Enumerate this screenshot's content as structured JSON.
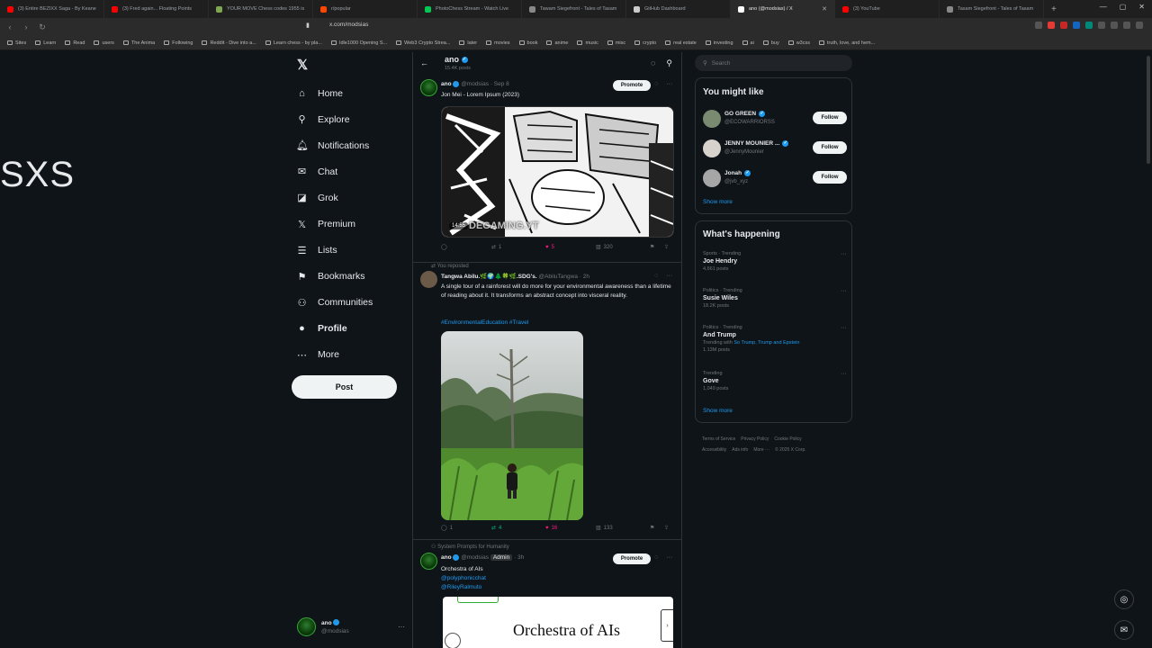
{
  "browser": {
    "tabs": [
      {
        "label": "(3) Entire BEZIXX Saga - By Keane",
        "color": "#ff0000"
      },
      {
        "label": "(3) Fred again... Floating Points",
        "color": "#ff0000"
      },
      {
        "label": "YOUR MOVE Chess codes 1955 is",
        "color": "#7fa650"
      },
      {
        "label": "r/popular",
        "color": "#ff4500"
      },
      {
        "label": "PhotoChess Stream - Watch Live",
        "color": "#00c853"
      },
      {
        "label": "Tawam Siegefront - Tales of Tasam",
        "color": "#888888"
      },
      {
        "label": "GitHub Dashboard",
        "color": "#cccccc"
      },
      {
        "label": "ano (@modsias) / X",
        "color": "#ffffff"
      },
      {
        "label": "(3) YouTube",
        "color": "#ff0000"
      },
      {
        "label": "Tasam Siegefront - Tales of Tasam",
        "color": "#888888"
      }
    ],
    "url": "x.com/modsias",
    "bookmarks": [
      "Sites",
      "Learn",
      "Read",
      "users",
      "The Anima",
      "Following",
      "Reddit - Dive into a...",
      "Learn chess - by pla...",
      "Idle1000 Opening S...",
      "Web3 Crypto Strea...",
      "later",
      "movies",
      "book",
      "anime",
      "music",
      "misc",
      "crypto",
      "real estate",
      "investing",
      "ai",
      "buy",
      "w3css",
      "truth, love, and hem..."
    ]
  },
  "overlay_text": "SXS",
  "nav": {
    "items": [
      {
        "label": "Home",
        "icon": "⌂",
        "name": "home"
      },
      {
        "label": "Explore",
        "icon": "⚲",
        "name": "explore"
      },
      {
        "label": "Notifications",
        "icon": "🔔︎",
        "name": "notifications"
      },
      {
        "label": "Chat",
        "icon": "✉",
        "name": "chat"
      },
      {
        "label": "Grok",
        "icon": "◪",
        "name": "grok"
      },
      {
        "label": "Premium",
        "icon": "𝕏",
        "name": "premium"
      },
      {
        "label": "Lists",
        "icon": "☰",
        "name": "lists"
      },
      {
        "label": "Bookmarks",
        "icon": "⚑",
        "name": "bookmarks"
      },
      {
        "label": "Communities",
        "icon": "⚇",
        "name": "communities"
      },
      {
        "label": "Profile",
        "icon": "●",
        "name": "profile"
      },
      {
        "label": "More",
        "icon": "⋯",
        "name": "more"
      }
    ],
    "post_label": "Post",
    "account": {
      "name": "ano",
      "handle": "@modsias"
    }
  },
  "header": {
    "name": "ano",
    "posts": "15.4K posts"
  },
  "tweets": [
    {
      "name": "ano",
      "handle": "@modsias",
      "time": "· Sep 8",
      "promote": "Promote",
      "text": "Jon Mei - Lorem Ipsum (2023)",
      "video_time": "14:55",
      "watermark": "DEGAMING.YT",
      "replies": "",
      "reposts": "1",
      "likes": "5",
      "views": "320"
    },
    {
      "social": "You reposted",
      "name": "Tangwa Abilu.🌿🌍🌲🍀🌿.SDG's.",
      "handle": "@AbiluTangwa",
      "time": "· 2h",
      "text": "A single tour of a rainforest will do more for your environmental awareness than a lifetime of reading about it. It transforms an abstract concept into visceral reality.",
      "hashtags": "#EnvironmentalEducation #Travel",
      "replies": "1",
      "reposts": "4",
      "likes": "16",
      "views": "133"
    },
    {
      "social": "System Prompts for Humanity",
      "name": "ano",
      "handle": "@modsias",
      "badge": "Admin",
      "time": "· 3h",
      "promote": "Promote",
      "text": "Orchestra of AIs",
      "mention1": "@polyphonicchat",
      "mention2": "@RileyRalmuto",
      "card_title": "Orchestra of AIs"
    }
  ],
  "right": {
    "search_placeholder": "Search",
    "you_might_like": "You might like",
    "follow_label": "Follow",
    "suggestions": [
      {
        "name": "GO GREEN",
        "handle": "@ECOWARRIORSS"
      },
      {
        "name": "JENNY MOUNIER ...",
        "handle": "@JennyMounier"
      },
      {
        "name": "Jonah",
        "handle": "@jvb_xyz"
      }
    ],
    "show_more": "Show more",
    "whats_happening": "What's happening",
    "trends": [
      {
        "category": "Sports · Trending",
        "title": "Joe Hendry",
        "posts": "4,661 posts"
      },
      {
        "category": "Politics · Trending",
        "title": "Susie Wiles",
        "posts": "18.2K posts"
      },
      {
        "category": "Politics · Trending",
        "title": "And Trump",
        "with_prefix": "Trending with",
        "with_a": "So Trump",
        "with_b": "Trump and Epstein",
        "posts": "1.13M posts"
      },
      {
        "category": "Trending",
        "title": "Gove",
        "posts": "1,049 posts"
      }
    ],
    "footer": [
      "Terms of Service",
      "Privacy Policy",
      "Cookie Policy",
      "Accessibility",
      "Ads info",
      "More ···",
      "© 2025 X Corp."
    ]
  }
}
